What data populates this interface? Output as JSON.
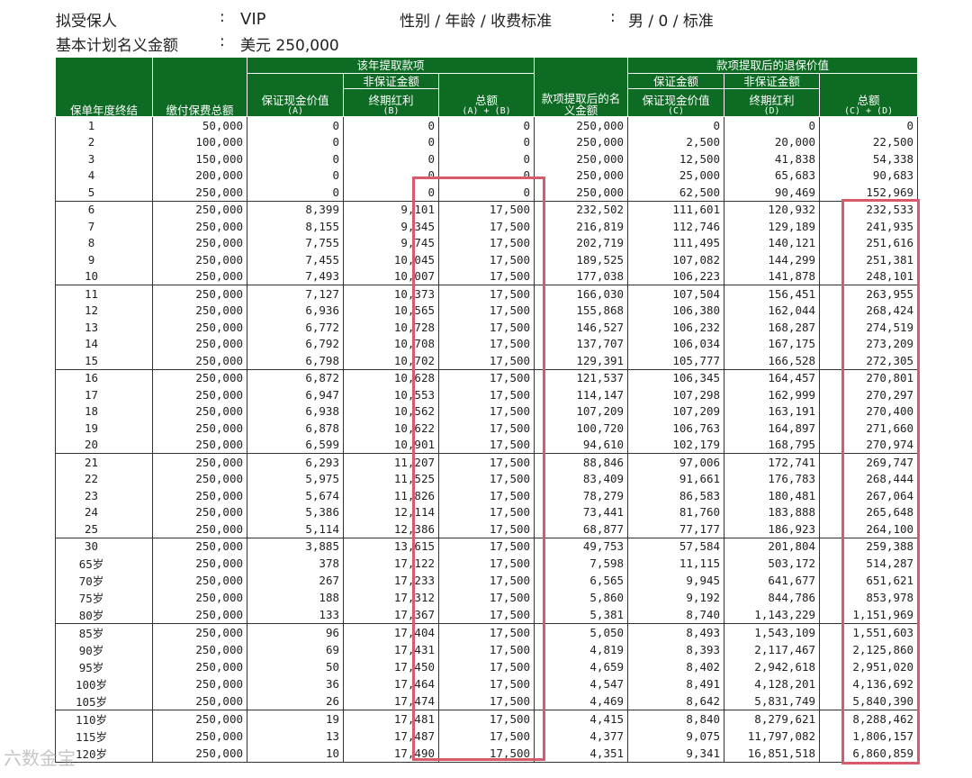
{
  "header": {
    "insured_label": "拟受保人",
    "insured_colon": ":",
    "insured_value": "VIP",
    "gender_label": "性别 / 年龄 / 收费标准",
    "gender_colon": ":",
    "gender_value": "男 / 0 / 标准",
    "notional_label": "基本计划名义金额",
    "notional_colon": ":",
    "notional_value": "美元 250,000"
  },
  "table": {
    "headers": {
      "year_end": "保单年度终结",
      "total_premium": "缴付保费总额",
      "withdrawal_group": "该年提取款项",
      "non_guaranteed_1": "非保证金额",
      "guaranteed_cash_1": "保证现金价值",
      "guaranteed_cash_1_sub": "(A)",
      "terminal_bonus_1": "终期红利",
      "terminal_bonus_1_sub": "(B)",
      "total_1": "总额",
      "total_1_sub": "(A) + (B)",
      "notional_after": "款项提取后的名义金额",
      "surrender_group": "款项提取后的退保价值",
      "guaranteed_amount_2": "保证金额",
      "non_guaranteed_2": "非保证金额",
      "guaranteed_cash_2": "保证现金价值",
      "guaranteed_cash_2_sub": "(C)",
      "terminal_bonus_2": "终期红利",
      "terminal_bonus_2_sub": "(D)",
      "total_2": "总额",
      "total_2_sub": "(C) + (D)"
    },
    "rows": [
      [
        "1",
        "50,000",
        "0",
        "0",
        "0",
        "250,000",
        "0",
        "0",
        "0"
      ],
      [
        "2",
        "100,000",
        "0",
        "0",
        "0",
        "250,000",
        "2,500",
        "20,000",
        "22,500"
      ],
      [
        "3",
        "150,000",
        "0",
        "0",
        "0",
        "250,000",
        "12,500",
        "41,838",
        "54,338"
      ],
      [
        "4",
        "200,000",
        "0",
        "0",
        "0",
        "250,000",
        "25,000",
        "65,683",
        "90,683"
      ],
      [
        "5",
        "250,000",
        "0",
        "0",
        "0",
        "250,000",
        "62,500",
        "90,469",
        "152,969"
      ],
      [
        "6",
        "250,000",
        "8,399",
        "9,101",
        "17,500",
        "232,502",
        "111,601",
        "120,932",
        "232,533"
      ],
      [
        "7",
        "250,000",
        "8,155",
        "9,345",
        "17,500",
        "216,819",
        "112,746",
        "129,189",
        "241,935"
      ],
      [
        "8",
        "250,000",
        "7,755",
        "9,745",
        "17,500",
        "202,719",
        "111,495",
        "140,121",
        "251,616"
      ],
      [
        "9",
        "250,000",
        "7,455",
        "10,045",
        "17,500",
        "189,525",
        "107,082",
        "144,299",
        "251,381"
      ],
      [
        "10",
        "250,000",
        "7,493",
        "10,007",
        "17,500",
        "177,038",
        "106,223",
        "141,878",
        "248,101"
      ],
      [
        "11",
        "250,000",
        "7,127",
        "10,373",
        "17,500",
        "166,030",
        "107,504",
        "156,451",
        "263,955"
      ],
      [
        "12",
        "250,000",
        "6,936",
        "10,565",
        "17,500",
        "155,868",
        "106,380",
        "162,044",
        "268,424"
      ],
      [
        "13",
        "250,000",
        "6,772",
        "10,728",
        "17,500",
        "146,527",
        "106,232",
        "168,287",
        "274,519"
      ],
      [
        "14",
        "250,000",
        "6,792",
        "10,708",
        "17,500",
        "137,707",
        "106,034",
        "167,175",
        "273,209"
      ],
      [
        "15",
        "250,000",
        "6,798",
        "10,702",
        "17,500",
        "129,391",
        "105,777",
        "166,528",
        "272,305"
      ],
      [
        "16",
        "250,000",
        "6,872",
        "10,628",
        "17,500",
        "121,537",
        "106,345",
        "164,457",
        "270,801"
      ],
      [
        "17",
        "250,000",
        "6,947",
        "10,553",
        "17,500",
        "114,147",
        "107,298",
        "162,999",
        "270,297"
      ],
      [
        "18",
        "250,000",
        "6,938",
        "10,562",
        "17,500",
        "107,209",
        "107,209",
        "163,191",
        "270,400"
      ],
      [
        "19",
        "250,000",
        "6,878",
        "10,622",
        "17,500",
        "100,720",
        "106,763",
        "164,897",
        "271,660"
      ],
      [
        "20",
        "250,000",
        "6,599",
        "10,901",
        "17,500",
        "94,610",
        "102,179",
        "168,795",
        "270,974"
      ],
      [
        "21",
        "250,000",
        "6,293",
        "11,207",
        "17,500",
        "88,846",
        "97,006",
        "172,741",
        "269,747"
      ],
      [
        "22",
        "250,000",
        "5,975",
        "11,525",
        "17,500",
        "83,409",
        "91,661",
        "176,783",
        "268,444"
      ],
      [
        "23",
        "250,000",
        "5,674",
        "11,826",
        "17,500",
        "78,279",
        "86,583",
        "180,481",
        "267,064"
      ],
      [
        "24",
        "250,000",
        "5,386",
        "12,114",
        "17,500",
        "73,441",
        "81,760",
        "183,888",
        "265,648"
      ],
      [
        "25",
        "250,000",
        "5,114",
        "12,386",
        "17,500",
        "68,877",
        "77,177",
        "186,923",
        "264,100"
      ],
      [
        "30",
        "250,000",
        "3,885",
        "13,615",
        "17,500",
        "49,753",
        "57,584",
        "201,804",
        "259,388"
      ],
      [
        "65岁",
        "250,000",
        "378",
        "17,122",
        "17,500",
        "7,598",
        "11,115",
        "503,172",
        "514,287"
      ],
      [
        "70岁",
        "250,000",
        "267",
        "17,233",
        "17,500",
        "6,565",
        "9,945",
        "641,677",
        "651,621"
      ],
      [
        "75岁",
        "250,000",
        "188",
        "17,312",
        "17,500",
        "5,860",
        "9,192",
        "844,786",
        "853,978"
      ],
      [
        "80岁",
        "250,000",
        "133",
        "17,367",
        "17,500",
        "5,381",
        "8,740",
        "1,143,229",
        "1,151,969"
      ],
      [
        "85岁",
        "250,000",
        "96",
        "17,404",
        "17,500",
        "5,050",
        "8,493",
        "1,543,109",
        "1,551,603"
      ],
      [
        "90岁",
        "250,000",
        "69",
        "17,431",
        "17,500",
        "4,819",
        "8,393",
        "2,117,467",
        "2,125,860"
      ],
      [
        "95岁",
        "250,000",
        "50",
        "17,450",
        "17,500",
        "4,659",
        "8,402",
        "2,942,618",
        "2,951,020"
      ],
      [
        "100岁",
        "250,000",
        "36",
        "17,464",
        "17,500",
        "4,547",
        "8,491",
        "4,128,201",
        "4,136,692"
      ],
      [
        "105岁",
        "250,000",
        "26",
        "17,474",
        "17,500",
        "4,469",
        "8,642",
        "5,831,749",
        "5,840,390"
      ],
      [
        "110岁",
        "250,000",
        "19",
        "17,481",
        "17,500",
        "4,415",
        "8,840",
        "8,279,621",
        "8,288,462"
      ],
      [
        "115岁",
        "250,000",
        "13",
        "17,487",
        "17,500",
        "4,377",
        "9,075",
        "11,797,082",
        "1,806,157"
      ],
      [
        "120岁",
        "250,000",
        "10",
        "17,490",
        "17,500",
        "4,351",
        "9,341",
        "16,851,518",
        "6,860,859"
      ]
    ],
    "group_start_rows": [
      5,
      10,
      15,
      20,
      25,
      30,
      35
    ]
  },
  "highlight_color": "#d95a6b",
  "header_bg_color": "#0e6b23",
  "watermark": "六数金宝"
}
